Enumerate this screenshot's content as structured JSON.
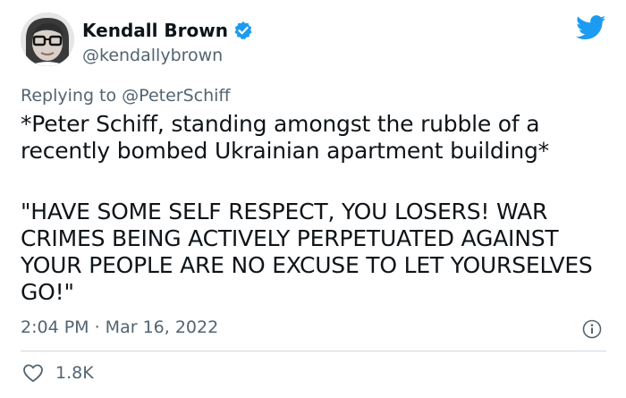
{
  "author": {
    "display_name": "Kendall Brown",
    "handle": "@kendallybrown",
    "verified": true,
    "avatar_icon": "avatar-photo"
  },
  "reply": {
    "prefix": "Replying to",
    "mention": "@PeterSchiff"
  },
  "tweet": {
    "paragraph_1": "*Peter Schiff, standing amongst the rubble of a recently bombed Ukrainian apartment building*",
    "paragraph_2": "\"HAVE SOME SELF RESPECT, YOU LOSERS! WAR CRIMES BEING ACTIVELY PERPETUATED AGAINST YOUR PEOPLE ARE NO EXCUSE TO LET YOURSELVES GO!\""
  },
  "meta": {
    "timestamp": "2:04 PM · Mar 16, 2022"
  },
  "engagement": {
    "likes": "1.8K"
  },
  "icons": {
    "brand": "twitter-bird-icon",
    "verified": "verified-badge-icon",
    "info": "info-icon",
    "like": "heart-icon"
  },
  "colors": {
    "twitter_blue": "#1d9bf0",
    "text_primary": "#0f1419",
    "text_secondary": "#536471",
    "divider": "#cfd9de"
  }
}
